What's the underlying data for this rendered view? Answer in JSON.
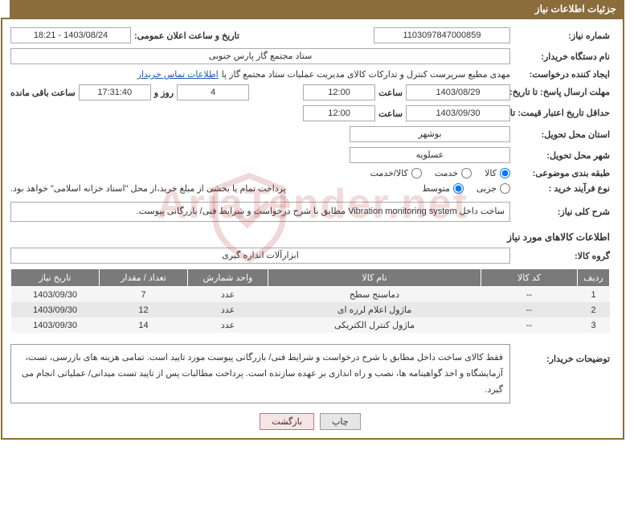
{
  "header": {
    "title": "جزئیات اطلاعات نیاز"
  },
  "fields": {
    "need_number_label": "شماره نیاز:",
    "need_number": "1103097847000859",
    "announce_label": "تاریخ و ساعت اعلان عمومی:",
    "announce": "1403/08/24 - 18:21",
    "device_label": "نام دستگاه خریدار:",
    "device": "ستاد مجتمع گاز پارس جنوبی",
    "requester_label": "ایجاد کننده درخواست:",
    "requester": "مهدی مطیع سرپرست کنترل و تدارکات کالای مدیریت عملیات ستاد مجتمع گاز پا",
    "contact_link": "اطلاعات تماس خریدار",
    "deadline_label": "مهلت ارسال پاسخ: تا تاریخ:",
    "deadline_date": "1403/08/29",
    "hour_label": "ساعت",
    "deadline_time": "12:00",
    "days_value": "4",
    "days_label": "روز و",
    "remain_time": "17:31:40",
    "remain_label": "ساعت باقی مانده",
    "validity_label": "حداقل تاریخ اعتبار قیمت: تا تاریخ:",
    "validity_date": "1403/09/30",
    "validity_time": "12:00",
    "province_label": "استان محل تحویل:",
    "province": "بوشهر",
    "city_label": "شهر محل تحویل:",
    "city": "عسلویه",
    "category_label": "طبقه بندی موضوعی:",
    "purchase_type_label": "نوع فرآیند خرید :",
    "payment_note": "پرداخت تمام یا بخشی از مبلغ خرید،از محل \"اسناد خزانه اسلامی\" خواهد بود.",
    "desc_label": "شرح کلی نیاز:",
    "desc": "ساخت داخل Vibration monitoring system مطابق با شرح درخواست و شرایط فنی/ بازرگانی پیوست.",
    "group_label": "گروه کالا:",
    "group": "ابزارآلات اندازه گیری",
    "explain_label": "توضیحات خریدار:",
    "explain": "فقط کالای ساخت داخل مطابق با شرح درخواست و شرایط فنی/ بازرگانی پیوست مورد تایید است. تمامی هزینه های بازرسی، تست، آزمایشگاه و اخذ گواهینامه ها، نصب و راه اندازی بر عهده سازنده است. پرداخت مطالبات پس از تایید تست میدانی/ عملیاتی انجام می گیرد."
  },
  "category_opts": [
    {
      "label": "کالا",
      "checked": true
    },
    {
      "label": "خدمت",
      "checked": false
    },
    {
      "label": "کالا/خدمت",
      "checked": false
    }
  ],
  "purchase_opts": [
    {
      "label": "جزیی",
      "checked": false
    },
    {
      "label": "متوسط",
      "checked": true
    }
  ],
  "goods_section_title": "اطلاعات کالاهای مورد نیاز",
  "table": {
    "headers": [
      "ردیف",
      "کد کالا",
      "نام کالا",
      "واحد شمارش",
      "تعداد / مقدار",
      "تاریخ نیاز"
    ],
    "rows": [
      {
        "no": "1",
        "code": "--",
        "name": "دماسنج سطح",
        "unit": "عدد",
        "qty": "7",
        "date": "1403/09/30"
      },
      {
        "no": "2",
        "code": "--",
        "name": "ماژول اعلام لرزه ای",
        "unit": "عدد",
        "qty": "12",
        "date": "1403/09/30"
      },
      {
        "no": "3",
        "code": "--",
        "name": "ماژول کنترل الکتریکی",
        "unit": "عدد",
        "qty": "14",
        "date": "1403/09/30"
      }
    ]
  },
  "buttons": {
    "print": "چاپ",
    "back": "بازگشت"
  },
  "watermark": "AriaTender.net"
}
